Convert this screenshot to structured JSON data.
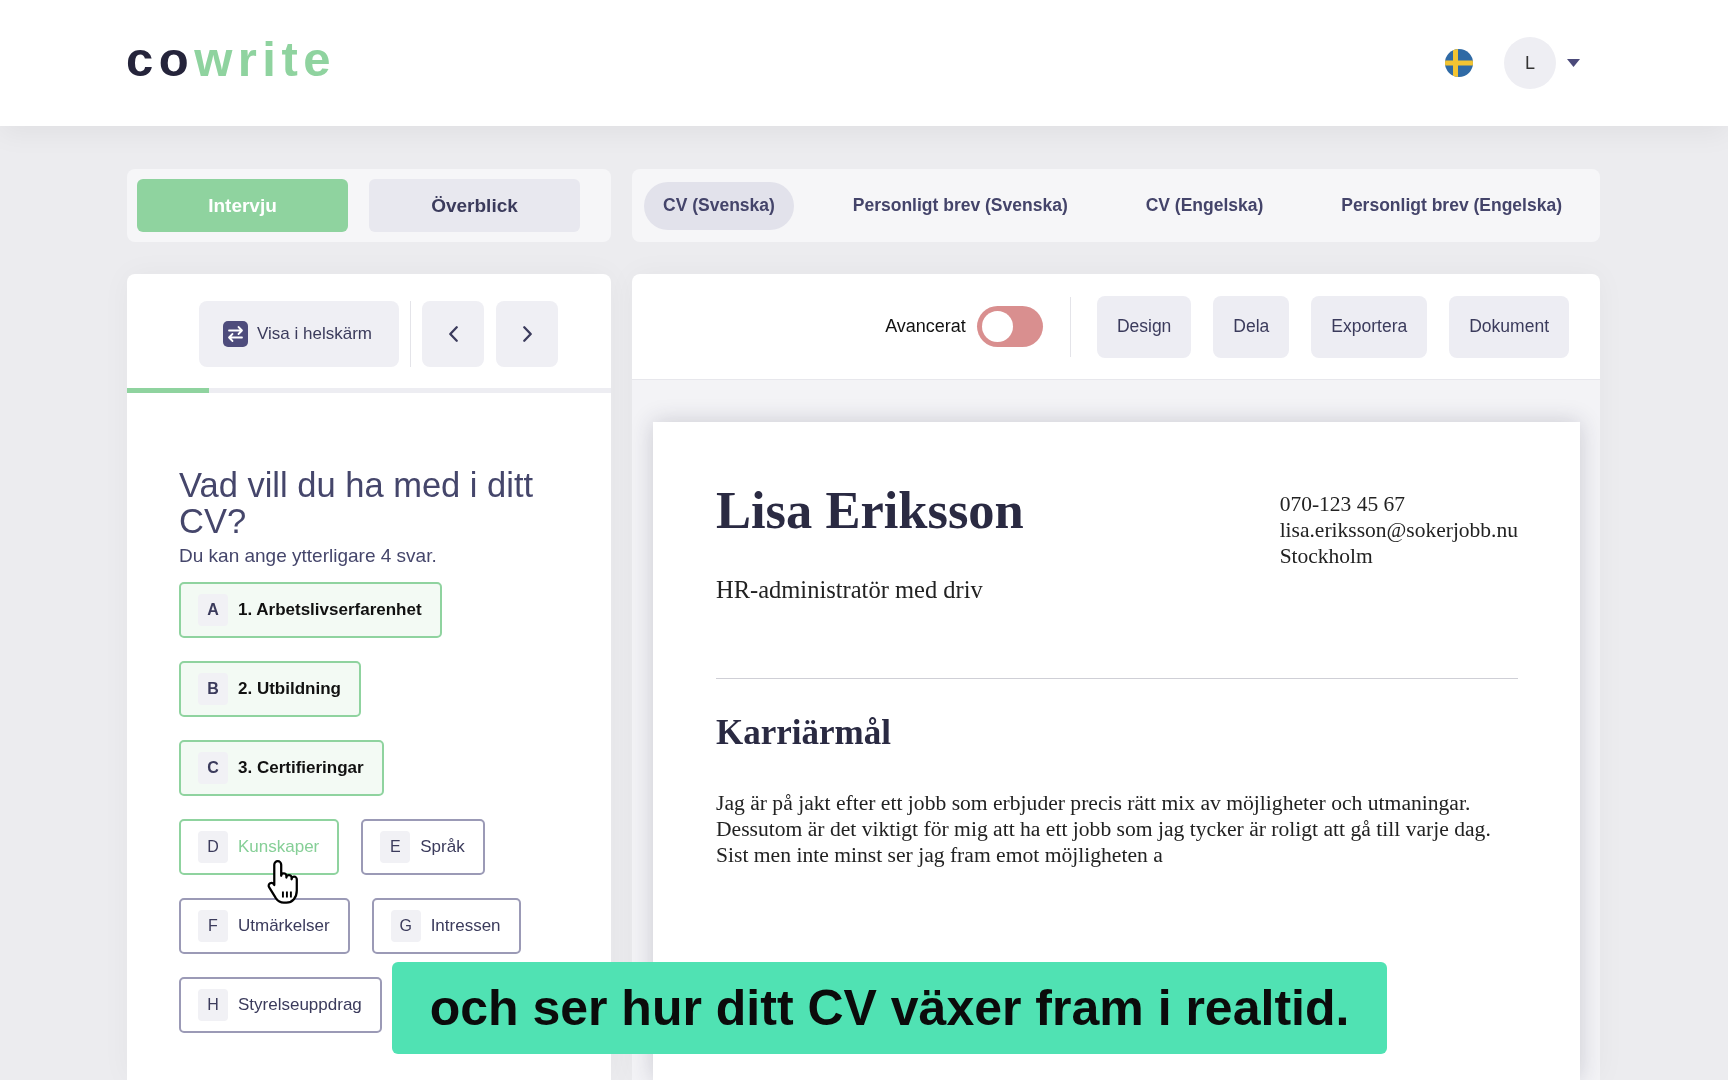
{
  "header": {
    "logo": [
      {
        "text": "co",
        "kind": "dark"
      },
      {
        "text": "write",
        "kind": "accent"
      }
    ],
    "avatar": {
      "initial": "L"
    }
  },
  "mode_tabs": [
    {
      "label": "Intervju",
      "selected": true
    },
    {
      "label": "Överblick",
      "selected": false
    }
  ],
  "document_tabs": [
    {
      "label": "CV (Svenska)",
      "selected": true
    },
    {
      "label": "Personligt brev (Svenska)",
      "selected": false
    },
    {
      "label": "CV (Engelska)",
      "selected": false
    },
    {
      "label": "Personligt brev (Engelska)",
      "selected": false
    }
  ],
  "interview_panel": {
    "fullscreen_button": "Visa i helskärm",
    "progress": {
      "level": 0.17
    },
    "question": "Vad vill du ha med i ditt CV?",
    "hint": "Du kan ange ytterligare 4 svar.",
    "options": [
      {
        "letter": "A",
        "label": "1. Arbetslivserfarenhet",
        "selected": true,
        "hovered": false
      },
      {
        "letter": "B",
        "label": "2. Utbildning",
        "selected": true,
        "hovered": false
      },
      {
        "letter": "C",
        "label": "3. Certifieringar",
        "selected": true,
        "hovered": false
      },
      {
        "letter": "D",
        "label": "Kunskaper",
        "selected": false,
        "hovered": true
      },
      {
        "letter": "E",
        "label": "Språk",
        "selected": false,
        "hovered": false
      },
      {
        "letter": "F",
        "label": "Utmärkelser",
        "selected": false,
        "hovered": false
      },
      {
        "letter": "G",
        "label": "Intressen",
        "selected": false,
        "hovered": false
      },
      {
        "letter": "H",
        "label": "Styrelseuppdrag",
        "selected": false,
        "hovered": false
      }
    ]
  },
  "editor_panel": {
    "advanced_toggle": {
      "label": "Avancerat",
      "on": false
    },
    "buttons": [
      "Design",
      "Dela",
      "Exportera",
      "Dokument"
    ],
    "resume": {
      "name": "Lisa Eriksson",
      "headline": "HR-administratör med driv",
      "contact": [
        "070-123 45 67",
        "lisa.eriksson@sokerjobb.nu",
        "Stockholm"
      ],
      "sections": [
        {
          "heading": "Karriärmål",
          "body": "Jag är på jakt efter ett jobb som erbjuder precis rätt mix av möjligheter och utmaningar. Dessutom är det viktigt för mig att ha ett jobb som jag tycker är roligt att gå till varje dag. Sist men inte minst ser jag fram emot möjligheten a"
        }
      ]
    }
  },
  "caption": "och ser hur ditt CV växer fram i realtid."
}
